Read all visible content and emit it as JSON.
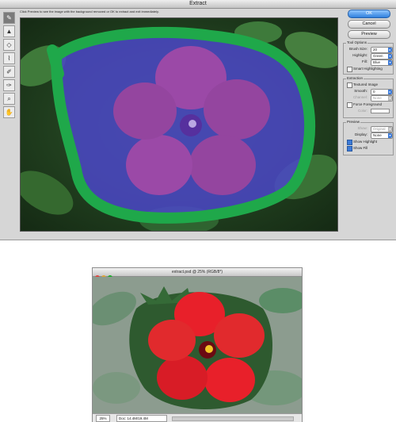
{
  "dialog": {
    "title": "Extract",
    "instructions": "Click Preview to see the image with the background removed or OK to extract and exit immediately.",
    "tools": [
      {
        "name": "edge-highlighter-tool",
        "glyph": "✎"
      },
      {
        "name": "fill-tool",
        "glyph": "▲"
      },
      {
        "name": "eraser-tool",
        "glyph": "◇"
      },
      {
        "name": "eyedropper-tool",
        "glyph": "⌇"
      },
      {
        "name": "cleanup-tool",
        "glyph": "✐"
      },
      {
        "name": "edge-touchup-tool",
        "glyph": "✑"
      },
      {
        "name": "zoom-tool",
        "glyph": "⌕"
      },
      {
        "name": "hand-tool",
        "glyph": "✋"
      }
    ],
    "buttons": {
      "ok": "OK",
      "cancel": "Cancel",
      "preview": "Preview"
    },
    "tool_options": {
      "title": "Tool Options",
      "brush_size_label": "Brush Size:",
      "brush_size_value": "20",
      "highlight_label": "Highlight:",
      "highlight_value": "Green",
      "fill_label": "Fill:",
      "fill_value": "Blue",
      "smart_highlighting": "Smart Highlighting"
    },
    "extraction": {
      "title": "Extraction",
      "textured_image": "Textured Image",
      "smooth_label": "Smooth:",
      "smooth_value": "0",
      "channel_label": "Channel:",
      "channel_value": "None",
      "force_foreground": "Force Foreground",
      "color_label": "Color:"
    },
    "preview": {
      "title": "Preview",
      "show_label": "Show:",
      "show_value": "Original",
      "display_label": "Display:",
      "display_value": "None",
      "show_highlight": "Show Highlight",
      "show_fill": "Show Fill"
    }
  },
  "document": {
    "title": "extract.psd @ 25% (RGB/8*)",
    "zoom": "25%",
    "doc_size": "Doc: 14.4M/19.4M"
  },
  "colors": {
    "highlight": "#1fa84a",
    "fill": "#4b47c8",
    "ok_button": "#2f7fdc",
    "flower_red": "#e8202a"
  }
}
